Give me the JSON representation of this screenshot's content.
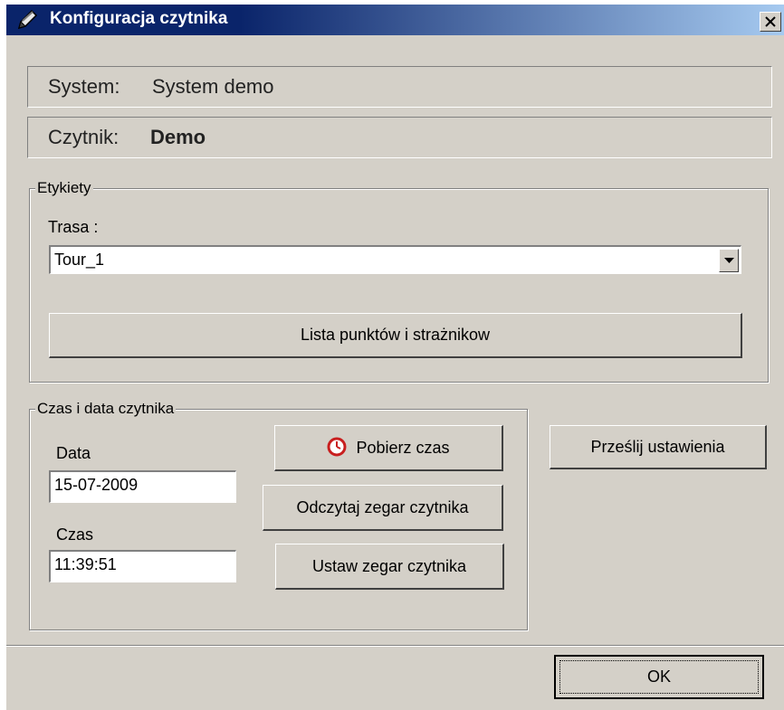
{
  "window": {
    "title": "Konfiguracja czytnika",
    "icon": "pen-icon"
  },
  "system": {
    "label": "System:",
    "value": "System demo"
  },
  "reader": {
    "label": "Czytnik:",
    "value": "Demo"
  },
  "labels_group": {
    "legend": "Etykiety",
    "route_label": "Trasa :",
    "route_value": "Tour_1",
    "list_button": "Lista punktów i strażnikow"
  },
  "time_group": {
    "legend": "Czas i data czytnika",
    "date_label": "Data",
    "date_value": "15-07-2009",
    "time_label": "Czas",
    "time_value": "11:39:51",
    "get_time_button": "Pobierz czas",
    "read_clock_button": "Odczytaj zegar czytnika",
    "set_clock_button": "Ustaw zegar czytnika"
  },
  "send_settings_button": "Prześlij ustawienia",
  "ok_button": "OK"
}
